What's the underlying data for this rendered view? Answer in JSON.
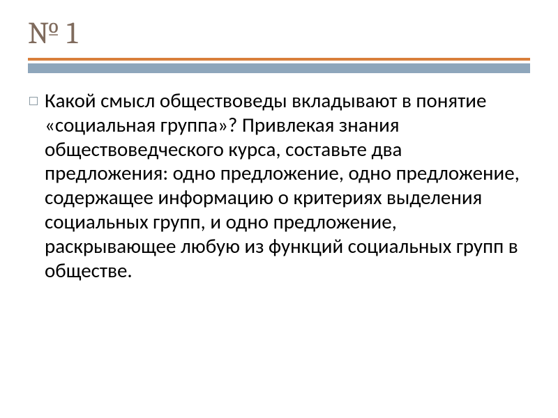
{
  "slide": {
    "title": "№ 1",
    "bullet_icon": "square-bullet-icon",
    "body": "Какой смысл обществоведы вкладывают в понятие «социальная группа»? Привлекая знания обществоведческого курса, составьте два предложения: одно предложение, одно предложение, содержащее информацию о критериях выделения социальных групп, и одно предложение, раскрывающее любую из функций социальных групп в обществе."
  }
}
